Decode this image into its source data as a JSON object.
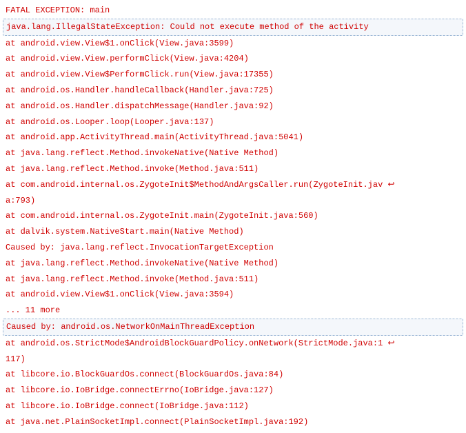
{
  "trace": [
    {
      "text": "FATAL EXCEPTION: main",
      "hl": false
    },
    {
      "text": "java.lang.IllegalStateException: Could not execute method of the activity",
      "hl": true
    },
    {
      "text": "at android.view.View$1.onClick(View.java:3599)",
      "hl": false
    },
    {
      "text": "at android.view.View.performClick(View.java:4204)",
      "hl": false
    },
    {
      "text": "at android.view.View$PerformClick.run(View.java:17355)",
      "hl": false
    },
    {
      "text": "at android.os.Handler.handleCallback(Handler.java:725)",
      "hl": false
    },
    {
      "text": "at android.os.Handler.dispatchMessage(Handler.java:92)",
      "hl": false
    },
    {
      "text": "at android.os.Looper.loop(Looper.java:137)",
      "hl": false
    },
    {
      "text": "at android.app.ActivityThread.main(ActivityThread.java:5041)",
      "hl": false
    },
    {
      "text": "at java.lang.reflect.Method.invokeNative(Native Method)",
      "hl": false
    },
    {
      "text": "at java.lang.reflect.Method.invoke(Method.java:511)",
      "hl": false
    },
    {
      "text": "at com.android.internal.os.ZygoteInit$MethodAndArgsCaller.run(ZygoteInit.jav ↩\na:793)",
      "hl": false
    },
    {
      "text": "at com.android.internal.os.ZygoteInit.main(ZygoteInit.java:560)",
      "hl": false
    },
    {
      "text": "at dalvik.system.NativeStart.main(Native Method)",
      "hl": false
    },
    {
      "text": "Caused by: java.lang.reflect.InvocationTargetException",
      "hl": false
    },
    {
      "text": "at java.lang.reflect.Method.invokeNative(Native Method)",
      "hl": false
    },
    {
      "text": "at java.lang.reflect.Method.invoke(Method.java:511)",
      "hl": false
    },
    {
      "text": "at android.view.View$1.onClick(View.java:3594)",
      "hl": false
    },
    {
      "text": "... 11 more",
      "hl": false
    },
    {
      "text": "Caused by: android.os.NetworkOnMainThreadException",
      "hl": true
    },
    {
      "text": "at android.os.StrictMode$AndroidBlockGuardPolicy.onNetwork(StrictMode.java:1 ↩\n117)",
      "hl": false
    },
    {
      "text": "at libcore.io.BlockGuardOs.connect(BlockGuardOs.java:84)",
      "hl": false
    },
    {
      "text": "at libcore.io.IoBridge.connectErrno(IoBridge.java:127)",
      "hl": false
    },
    {
      "text": "at libcore.io.IoBridge.connect(IoBridge.java:112)",
      "hl": false
    },
    {
      "text": "at java.net.PlainSocketImpl.connect(PlainSocketImpl.java:192)",
      "hl": false
    }
  ]
}
